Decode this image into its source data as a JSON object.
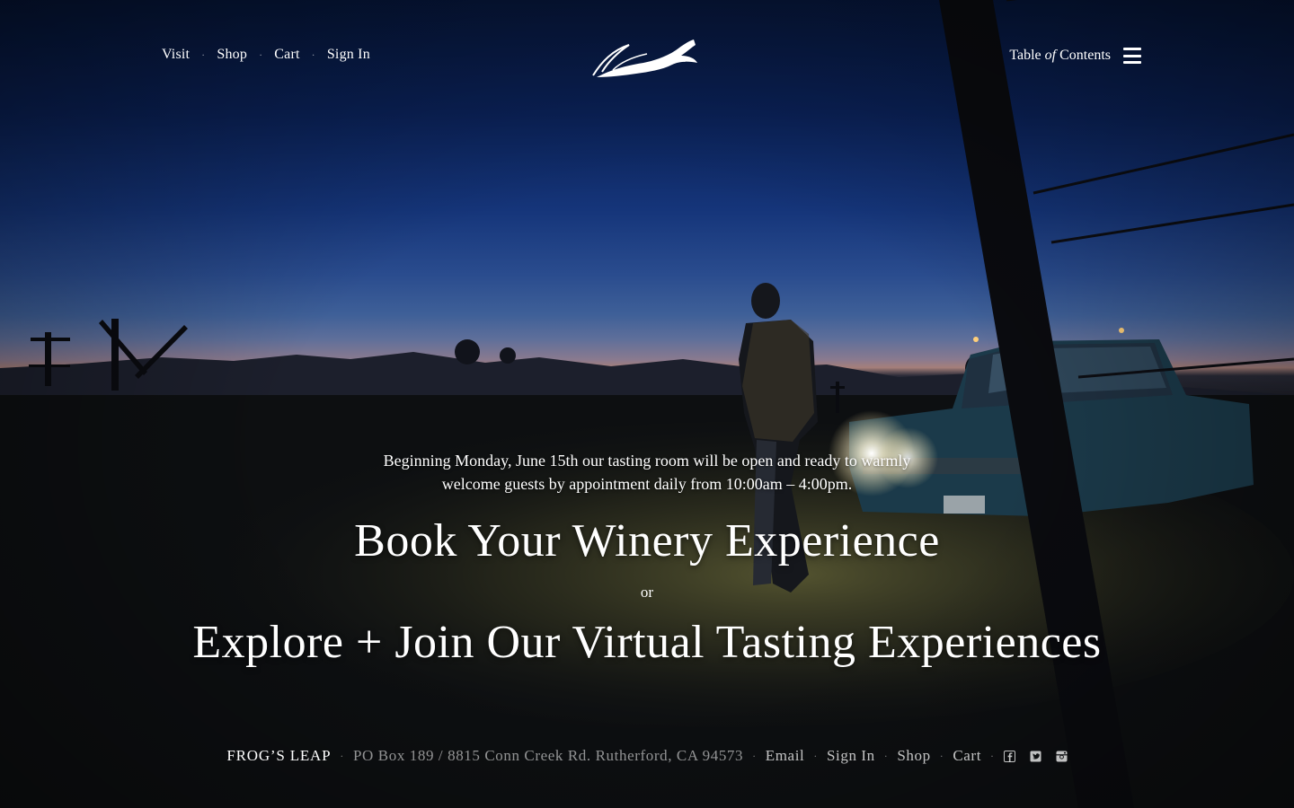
{
  "nav": {
    "left": [
      {
        "label": "Visit"
      },
      {
        "label": "Shop"
      },
      {
        "label": "Cart"
      },
      {
        "label": "Sign In"
      }
    ],
    "toc": {
      "prefix": "Table",
      "italic": "of",
      "suffix": "Contents"
    }
  },
  "hero": {
    "announcement_line1": "Beginning Monday, June 15th our tasting room will be open and ready to warmly",
    "announcement_line2": "welcome guests by appointment daily from 10:00am – 4:00pm.",
    "cta_primary": "Book Your Winery Experience",
    "or": "or",
    "cta_secondary": "Explore + Join Our Virtual Tasting Experiences"
  },
  "footer": {
    "brand": "FROG’S LEAP",
    "address": "PO Box 189 / 8815 Conn Creek Rd. Rutherford, CA 94573",
    "links": [
      {
        "label": "Email"
      },
      {
        "label": "Sign In"
      },
      {
        "label": "Shop"
      },
      {
        "label": "Cart"
      }
    ],
    "social": [
      "facebook-icon",
      "twitter-icon",
      "instagram-icon"
    ]
  },
  "colors": {
    "text": "#ffffff",
    "sky_top": "#06163a",
    "sky_mid": "#2a4c8e",
    "dusk_glow": "#a57f7a",
    "ground": "#0c0e10"
  }
}
